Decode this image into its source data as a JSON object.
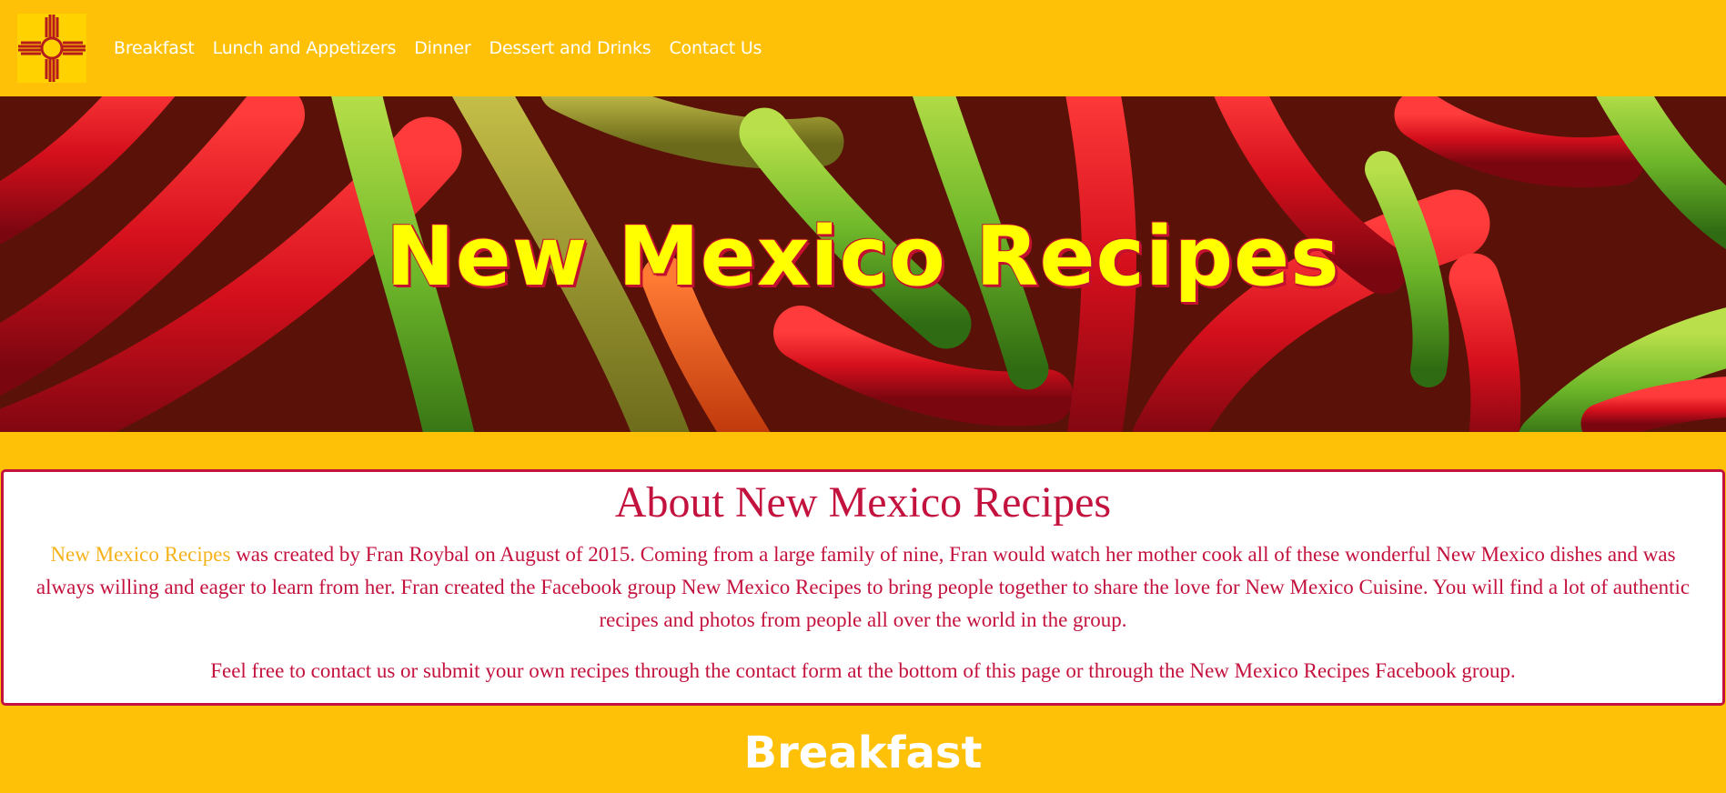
{
  "nav": {
    "logo_icon": "zia-sun-symbol-icon",
    "items": [
      {
        "label": "Breakfast"
      },
      {
        "label": "Lunch and Appetizers"
      },
      {
        "label": "Dinner"
      },
      {
        "label": "Dessert and Drinks"
      },
      {
        "label": "Contact Us"
      }
    ]
  },
  "hero": {
    "title": "New Mexico Recipes",
    "image": "red-and-green-chile-peppers"
  },
  "about": {
    "heading": "About New Mexico Recipes",
    "highlight": "New Mexico Recipes",
    "paragraph1_rest": " was created by Fran Roybal on August of 2015. Coming from a large family of nine, Fran would watch her mother cook all of these wonderful New Mexico dishes and was always willing and eager to learn from her. Fran created the Facebook group New Mexico Recipes to bring people together to share the love for New Mexico Cuisine. You will find a lot of authentic recipes and photos from people all over the world in the group.",
    "paragraph2": "Feel free to contact us or submit your own recipes through the contact form at the bottom of this page or through the New Mexico Recipes Facebook group."
  },
  "sections": {
    "breakfast_title": "Breakfast"
  },
  "colors": {
    "background": "#FFC107",
    "accent_red": "#C4123E",
    "title_yellow": "#FFFF00",
    "highlight_gold": "#F5B21B"
  }
}
